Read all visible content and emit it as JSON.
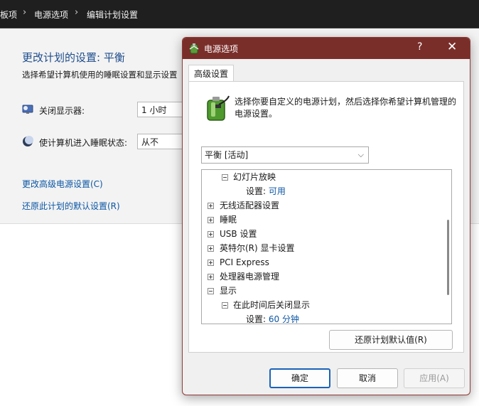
{
  "breadcrumb": {
    "items": [
      "板项",
      "电源选项",
      "编辑计划设置"
    ],
    "separator": "›"
  },
  "background": {
    "title": "更改计划的设置: 平衡",
    "subtitle": "选择希望计算机使用的睡眠设置和显示设置",
    "display_label": "关闭显示器:",
    "display_value": "1 小时",
    "sleep_label": "使计算机进入睡眠状态:",
    "sleep_value": "从不",
    "advanced_link": "更改高级电源设置(C)",
    "restore_link": "还原此计划的默认设置(R)"
  },
  "dialog": {
    "title": "电源选项",
    "help_glyph": "?",
    "close_glyph": "✕",
    "tab": "高级设置",
    "description": "选择你要自定义的电源计划，然后选择你希望计算机管理的电源设置。",
    "plan_select": "平衡 [活动]",
    "tree": [
      {
        "label": "幻灯片放映",
        "expander": "minus",
        "level": 1
      },
      {
        "label": "设置:",
        "value": "可用",
        "level": 2
      },
      {
        "label": "无线适配器设置",
        "expander": "plus",
        "level": 0
      },
      {
        "label": "睡眠",
        "expander": "plus",
        "level": 0
      },
      {
        "label": "USB 设置",
        "expander": "plus",
        "level": 0
      },
      {
        "label": "英特尔(R) 显卡设置",
        "expander": "plus",
        "level": 0
      },
      {
        "label": "PCI Express",
        "expander": "plus",
        "level": 0
      },
      {
        "label": "处理器电源管理",
        "expander": "plus",
        "level": 0
      },
      {
        "label": "显示",
        "expander": "minus",
        "level": 0
      },
      {
        "label": "在此时间后关闭显示",
        "expander": "minus",
        "level": 1
      },
      {
        "label": "设置:",
        "value": "60 分钟",
        "level": 2
      }
    ],
    "restore_button": "还原计划默认值(R)",
    "ok_button": "确定",
    "cancel_button": "取消",
    "apply_button": "应用(A)"
  },
  "colors": {
    "titlebar": "#7a2e2a",
    "link": "#0b56a4",
    "primary_border": "#1a63b8"
  }
}
